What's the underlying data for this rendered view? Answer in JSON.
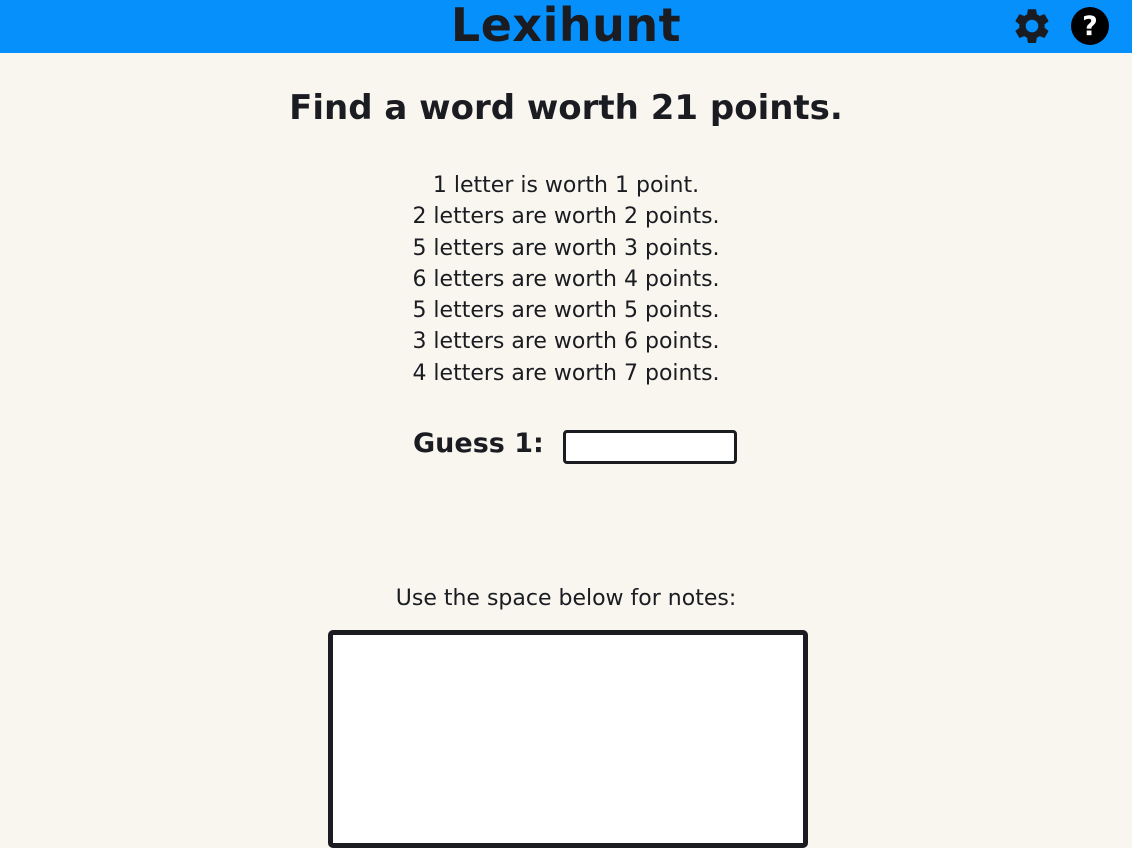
{
  "header": {
    "title": "Lexihunt",
    "background_color": "#0590fc",
    "settings_icon": "gear-icon",
    "help_icon": "question-circle-icon"
  },
  "puzzle": {
    "title": "Find a word worth 21 points.",
    "rules": [
      "1 letter is worth 1 point.",
      "2 letters are worth 2 points.",
      "5 letters are worth 3 points.",
      "6 letters are worth 4 points.",
      "5 letters are worth 5 points.",
      "3 letters are worth 6 points.",
      "4 letters are worth 7 points."
    ]
  },
  "guess": {
    "label": "Guess 1:",
    "value": ""
  },
  "notes": {
    "label": "Use the space below for notes:",
    "value": ""
  },
  "colors": {
    "page_background": "#f8f6ee",
    "text": "#1a1c22",
    "accent": "#0590fc"
  }
}
